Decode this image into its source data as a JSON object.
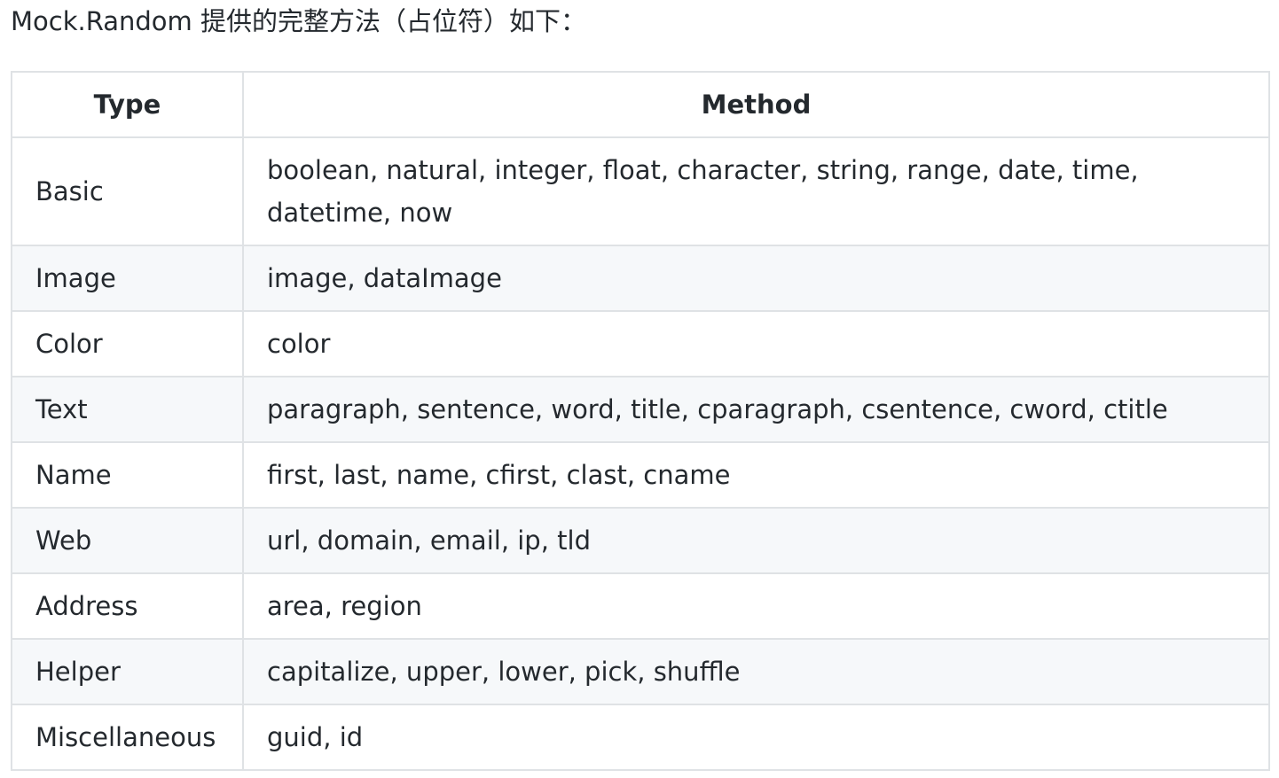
{
  "intro": "Mock.Random 提供的完整方法（占位符）如下：",
  "table": {
    "headers": {
      "type": "Type",
      "method": "Method"
    },
    "rows": [
      {
        "type": "Basic",
        "methods": "boolean, natural, integer, float, character, string, range, date, time, datetime, now"
      },
      {
        "type": "Image",
        "methods": "image, dataImage"
      },
      {
        "type": "Color",
        "methods": "color"
      },
      {
        "type": "Text",
        "methods": "paragraph, sentence, word, title, cparagraph, csentence, cword, ctitle"
      },
      {
        "type": "Name",
        "methods": "first, last, name, cfirst, clast, cname"
      },
      {
        "type": "Web",
        "methods": "url, domain, email, ip, tld"
      },
      {
        "type": "Address",
        "methods": "area, region"
      },
      {
        "type": "Helper",
        "methods": "capitalize, upper, lower, pick, shuffle"
      },
      {
        "type": "Miscellaneous",
        "methods": "guid, id"
      }
    ]
  }
}
